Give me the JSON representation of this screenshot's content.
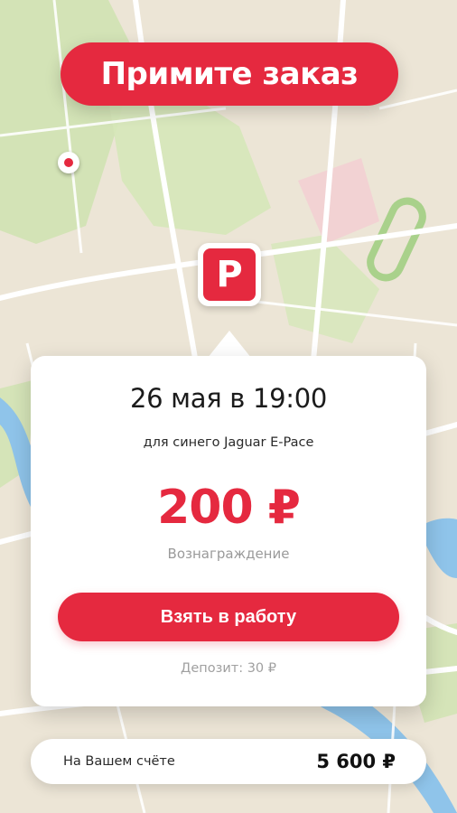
{
  "banner": {
    "title": "Примите заказ"
  },
  "map": {
    "parking_marker_letter": "P",
    "colors": {
      "land": "#ece5d6",
      "park": "#cfe3b0",
      "water": "#8fc4ea",
      "road": "#ffffff",
      "accent": "#e5293f",
      "zone": "#f3cfd3"
    }
  },
  "order_card": {
    "date_time": "26 мая в 19:00",
    "car_description": "для синего Jaguar E-Pace",
    "reward_amount": "200 ₽",
    "reward_label": "Вознаграждение",
    "take_button_label": "Взять в работу",
    "deposit_text": "Депозит: 30 ₽"
  },
  "balance": {
    "label": "На Вашем счёте",
    "value": "5 600 ₽"
  }
}
